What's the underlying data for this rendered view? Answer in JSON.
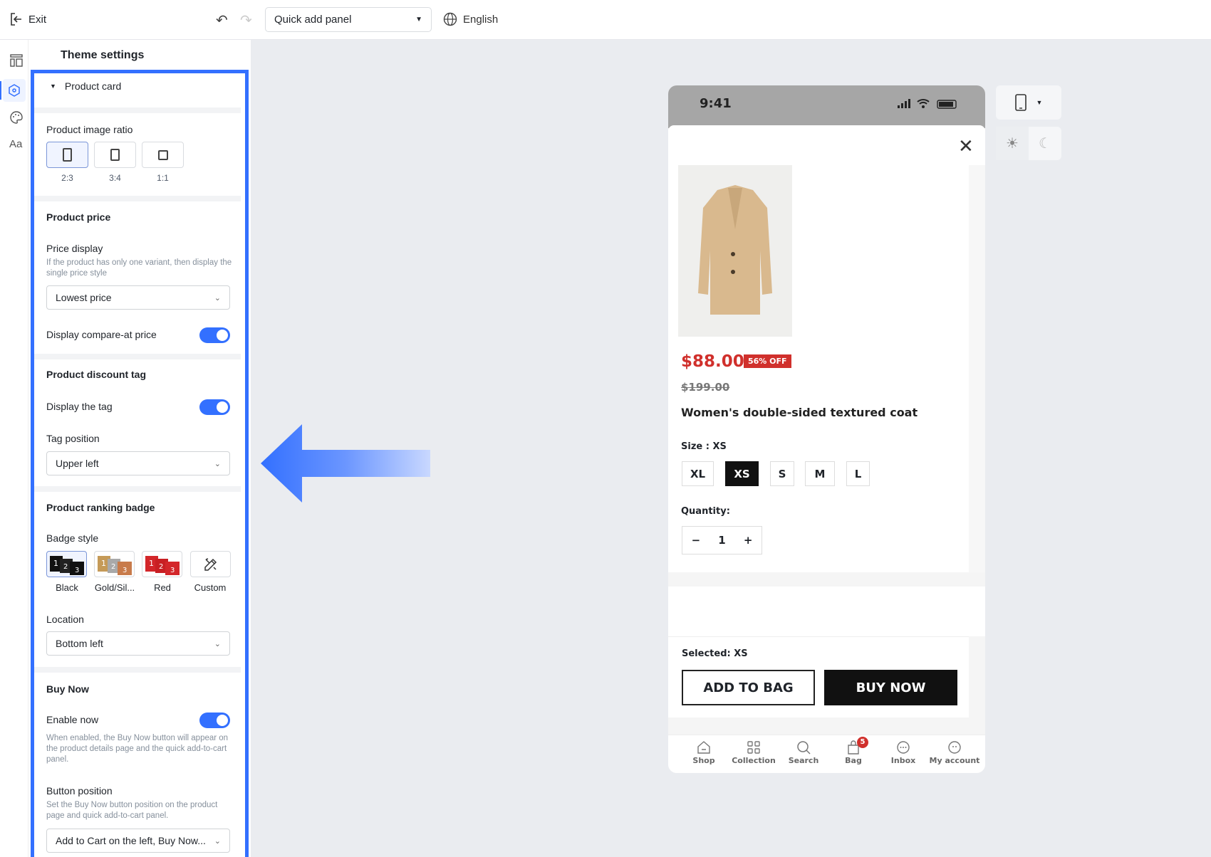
{
  "topbar": {
    "exit": "Exit",
    "panel_select": "Quick add panel",
    "language": "English"
  },
  "panel": {
    "title": "Theme settings",
    "section": "Product card",
    "image_ratio": {
      "label": "Product image ratio",
      "options": [
        "2:3",
        "3:4",
        "1:1"
      ],
      "selected": "2:3"
    },
    "price": {
      "heading": "Product price",
      "display_label": "Price display",
      "display_help": "If the product has only one variant, then display the single price style",
      "display_value": "Lowest price",
      "compare_label": "Display compare-at price",
      "compare_on": true
    },
    "discount": {
      "heading": "Product discount tag",
      "display_label": "Display the tag",
      "display_on": true,
      "position_label": "Tag position",
      "position_value": "Upper left"
    },
    "ranking": {
      "heading": "Product ranking badge",
      "style_label": "Badge style",
      "styles": [
        "Black",
        "Gold/Sil...",
        "Red",
        "Custom"
      ],
      "selected": "Black",
      "location_label": "Location",
      "location_value": "Bottom left"
    },
    "buynow": {
      "heading": "Buy Now",
      "enable_label": "Enable now",
      "enable_on": true,
      "enable_help": "When enabled, the Buy Now button will appear on the product details page and the quick add-to-cart panel.",
      "position_label": "Button position",
      "position_help": "Set the Buy Now button position on the product page and quick add-to-cart panel.",
      "position_value": "Add to Cart on the left, Buy Now..."
    }
  },
  "phone": {
    "time": "9:41",
    "price": "$88.00",
    "discount": "56% OFF",
    "old_price": "$199.00",
    "title": "Women's double-sided textured coat",
    "size_label": "Size : XS",
    "sizes": [
      "XL",
      "XS",
      "S",
      "M",
      "L"
    ],
    "selected_size": "XS",
    "quantity_label": "Quantity:",
    "quantity": "1",
    "selected": "Selected: XS",
    "add_to_bag": "ADD TO BAG",
    "buy_now": "BUY NOW",
    "tabs": [
      "Shop",
      "Collection",
      "Search",
      "Bag",
      "Inbox",
      "My account"
    ],
    "bag_count": "5"
  },
  "colors": {
    "accent": "#3370ff",
    "price": "#d0302c"
  }
}
